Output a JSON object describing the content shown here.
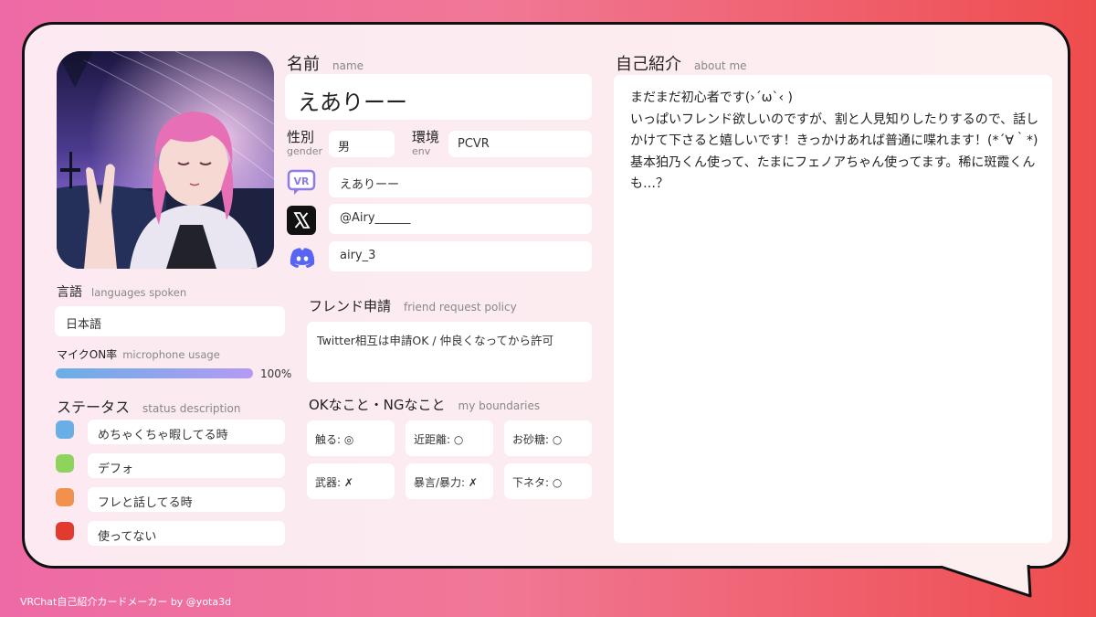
{
  "name_section": {
    "label": "名前",
    "sub": "name",
    "value": "えありーー"
  },
  "gender": {
    "label": "性別",
    "sub": "gender",
    "value": "男"
  },
  "env": {
    "label": "環境",
    "sub": "env",
    "value": "PCVR"
  },
  "accounts": {
    "vrchat": "えありーー",
    "x": "@Airy______",
    "discord": "airy_3"
  },
  "languages": {
    "label": "言語",
    "sub": "languages spoken",
    "value": "日本語"
  },
  "mic": {
    "label": "マイクON率",
    "sub": "microphone usage",
    "value": 100,
    "value_text": "100%"
  },
  "status": {
    "label": "ステータス",
    "sub": "status description",
    "items": [
      {
        "text": "めちゃくちゃ暇してる時",
        "color": "#6aaee6"
      },
      {
        "text": "デフォ",
        "color": "#8ed45c"
      },
      {
        "text": "フレと話してる時",
        "color": "#f2914e"
      },
      {
        "text": "使ってない",
        "color": "#e23a2e"
      }
    ]
  },
  "friend": {
    "label": "フレンド申請",
    "sub": "friend request policy",
    "value": "Twitter相互は申請OK / 仲良くなってから許可"
  },
  "boundaries": {
    "label": "OKなこと・NGなこと",
    "sub": "my boundaries",
    "items": [
      "触る: ◎",
      "近距離: ○",
      "お砂糖: ○",
      "武器: ✗",
      "暴言/暴力: ✗",
      "下ネタ: ○"
    ]
  },
  "about": {
    "label": "自己紹介",
    "sub": "about me",
    "text": "まだまだ初心者です(›´ω`‹ )\nいっぱいフレンド欲しいのですが、割と人見知りしたりするので、話しかけて下さると嬉しいです！きっかけあれば普通に喋れます！(*´∀｀*)\n基本狛乃くん使って、たまにフェノアちゃん使ってます。稀に斑霞くんも…？"
  },
  "footer": "VRChat自己紹介カードメーカー by @yota3d",
  "colors": {
    "accent_gradient_start": "#6aaee6",
    "accent_gradient_end": "#b59af3",
    "discord": "#5865f2",
    "vrchat": "#8f7be8"
  }
}
